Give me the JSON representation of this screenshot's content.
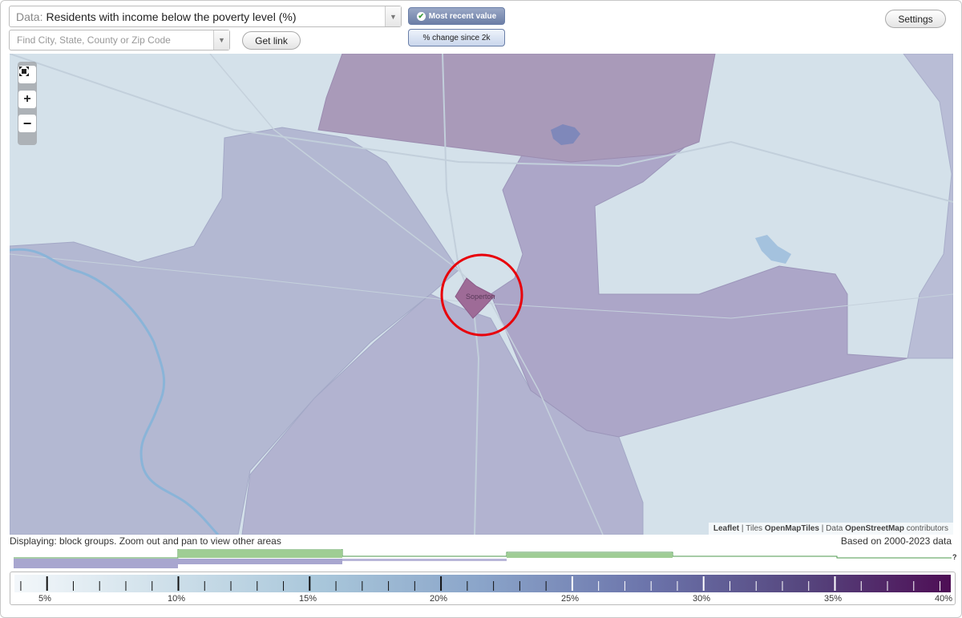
{
  "controls": {
    "data_prefix": "Data:",
    "data_value": "Residents with income below the poverty level (%)",
    "search_placeholder": "Find City, State, County or Zip Code",
    "get_link_label": "Get link",
    "most_recent_label": "Most recent value",
    "pct_change_label": "% change since 2k",
    "settings_label": "Settings",
    "dropdown_icon": "chevron-down-icon"
  },
  "map": {
    "town_label": "Soperton",
    "zoom_extent_icon": "fullscreen-icon",
    "zoom_in_icon": "plus-icon",
    "zoom_out_icon": "minus-icon",
    "zoom_in_glyph": "+",
    "zoom_out_glyph": "−",
    "attribution": {
      "leaflet": "Leaflet",
      "sep1": "|",
      "tiles_prefix": "Tiles",
      "tiles": "OpenMapTiles",
      "sep2": "|",
      "data_prefix": "Data",
      "data": "OpenStreetMap",
      "suffix": "contributors"
    },
    "highlight_color": "#e8000a"
  },
  "footer": {
    "displaying": "Displaying: block groups. Zoom out and pan to view other areas",
    "based_on": "Based on 2000-2023 data",
    "histogram_help": "?"
  },
  "legend": {
    "labels": [
      "5%",
      "10%",
      "15%",
      "20%",
      "25%",
      "30%",
      "35%",
      "40%"
    ],
    "colors": {
      "low": "#f3f7fa",
      "mid": "#8aa4c9",
      "high": "#4e0e55"
    }
  }
}
